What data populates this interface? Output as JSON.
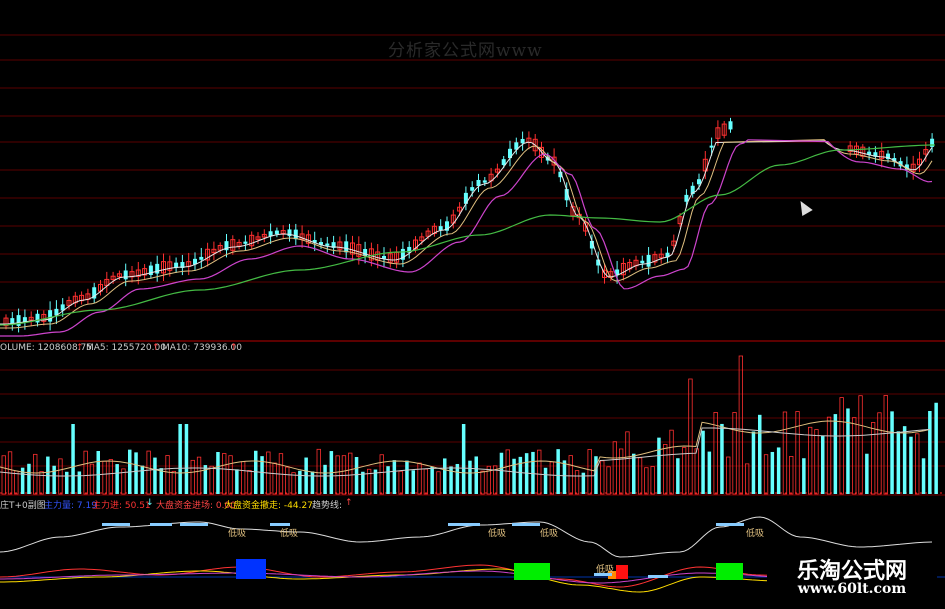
{
  "watermark": "分析家公式网www",
  "volume_header": {
    "volume_label": "OLUME: 1208608.75",
    "ma5_label": "MA5: 1255720.00",
    "ma10_label": "MA10: 739936.00",
    "arrow": "↑"
  },
  "indicator_header": {
    "title": "庄T+0副图",
    "items": [
      {
        "text": "主力量: 7.19",
        "color": "#3355ff"
      },
      {
        "text": "主力进: 50.51",
        "color": "#ff3333"
      },
      {
        "text": "大盘资金进场: 0.00",
        "color": "#ff4444"
      },
      {
        "text": "大盘资金撤走: -44.27",
        "color": "#ffdd00"
      },
      {
        "text": "趋势线:",
        "color": "#cccccc"
      }
    ],
    "arrows": [
      "↓",
      "↑"
    ]
  },
  "signal_labels": [
    "低吸",
    "低吸",
    "低吸",
    "低吸",
    "低吸",
    "低吸"
  ],
  "brand": {
    "name": "乐淘公式网",
    "url": "www.60lt.com"
  },
  "colors": {
    "up": "#ff3030",
    "down": "#66ffff",
    "ma_white": "#e8e8e8",
    "ma_yellow": "#e0c080",
    "ma_magenta": "#cc44cc",
    "ma_green": "#44bb44",
    "grid": "#7a0000",
    "block_blue": "#0033ff",
    "block_green": "#00ee00",
    "block_red": "#ff1111"
  }
}
